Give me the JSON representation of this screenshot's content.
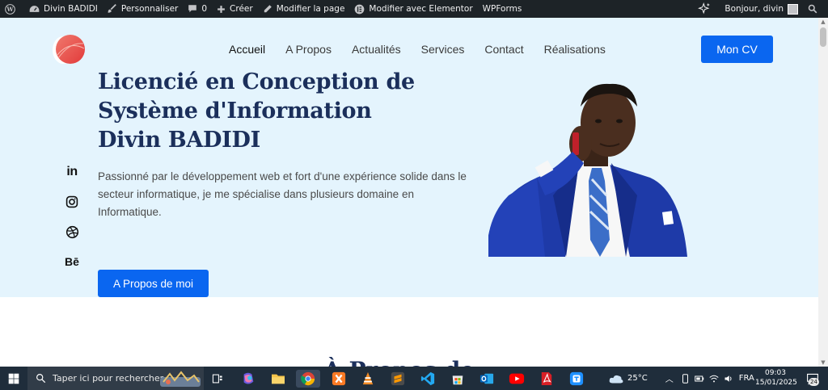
{
  "adminbar": {
    "site_name": "Divin BADIDI",
    "customize": "Personnaliser",
    "comments_count": "0",
    "new": "Créer",
    "edit_page": "Modifier la page",
    "edit_elementor": "Modifier avec Elementor",
    "wpforms": "WPForms",
    "greeting": "Bonjour, divin"
  },
  "nav": {
    "items": [
      "Accueil",
      "A Propos",
      "Actualités",
      "Services",
      "Contact",
      "Réalisations"
    ],
    "active": "Accueil",
    "cv_button": "Mon CV"
  },
  "hero": {
    "headline_line1": "Licencié en Conception de",
    "headline_line2": "Système d'Information",
    "headline_line3": "Divin BADIDI",
    "intro": "Passionné par le développement web et fort d'une expérience solide dans le secteur informatique, je me spécialise dans plusieurs domaine en Informatique.",
    "cta": "A Propos de moi",
    "social": [
      "linkedin-icon",
      "instagram-icon",
      "dribbble-icon",
      "behance-icon"
    ],
    "behance_text": "Bē",
    "linkedin_text": "in"
  },
  "section_peek": "À Propos de moi",
  "taskbar": {
    "search_placeholder": "Taper ici pour rechercher",
    "weather": "25°C",
    "language": "FRA",
    "time": "09:03",
    "date": "15/01/2025",
    "notification_count": "24"
  },
  "colors": {
    "accent": "#0a66f0",
    "hero_bg": "#e4f4fd",
    "heading": "#1b2f5b",
    "adminbar": "#1d2327",
    "taskbar": "#1f2d3b"
  }
}
